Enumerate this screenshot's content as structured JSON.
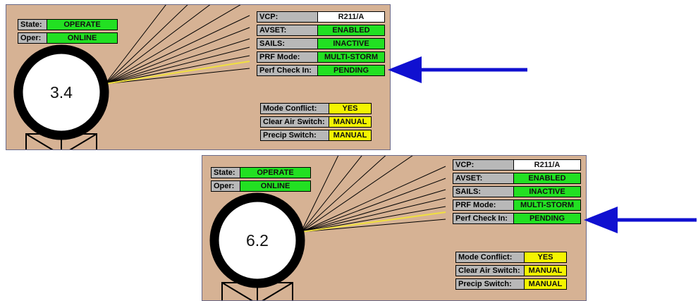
{
  "panels": [
    {
      "state_label": "State:",
      "state_value": "OPERATE",
      "oper_label": "Oper:",
      "oper_value": "ONLINE",
      "elevation": "3.4",
      "vcp_label": "VCP:",
      "vcp_value": "R211/A",
      "avset_label": "AVSET:",
      "avset_value": "ENABLED",
      "sails_label": "SAILS:",
      "sails_value": "INACTIVE",
      "prf_label": "PRF Mode:",
      "prf_value": "MULTI-STORM",
      "perf_label": "Perf Check In:",
      "perf_value": "PENDING",
      "mode_conflict_label": "Mode Conflict:",
      "mode_conflict_value": "YES",
      "clear_air_label": "Clear Air Switch:",
      "clear_air_value": "MANUAL",
      "precip_label": "Precip Switch:",
      "precip_value": "MANUAL"
    },
    {
      "state_label": "State:",
      "state_value": "OPERATE",
      "oper_label": "Oper:",
      "oper_value": "ONLINE",
      "elevation": "6.2",
      "vcp_label": "VCP:",
      "vcp_value": "R211/A",
      "avset_label": "AVSET:",
      "avset_value": "ENABLED",
      "sails_label": "SAILS:",
      "sails_value": "INACTIVE",
      "prf_label": "PRF Mode:",
      "prf_value": "MULTI-STORM",
      "perf_label": "Perf Check In:",
      "perf_value": "PENDING",
      "mode_conflict_label": "Mode Conflict:",
      "mode_conflict_value": "YES",
      "clear_air_label": "Clear Air Switch:",
      "clear_air_value": "MANUAL",
      "precip_label": "Precip Switch:",
      "precip_value": "MANUAL"
    }
  ],
  "colors": {
    "panel_bg": "#d6b294",
    "status_green": "#22e022",
    "status_yellow": "#f4f400",
    "arrow_blue": "#1010d0",
    "active_beam": "#f0e040"
  },
  "icons": {
    "arrow": "left-arrow-icon",
    "antenna": "radar-antenna-icon"
  }
}
